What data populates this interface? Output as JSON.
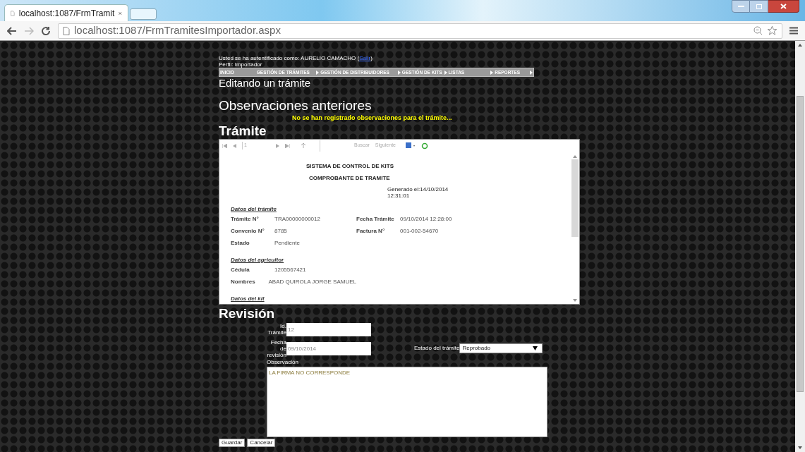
{
  "browser": {
    "tab_title": "localhost:1087/FrmTramit",
    "url": "localhost:1087/FrmTramitesImportador.aspx"
  },
  "header": {
    "auth_text": "Usted se ha autentificado como: AURELIO CAMACHO (",
    "logout_link": "Salir",
    "auth_end": ")",
    "profile": "Perfil: Importador"
  },
  "nav": [
    {
      "label": "INICIO",
      "submenu": false
    },
    {
      "label": "GESTIÓN DE TRÁMITES",
      "submenu": true
    },
    {
      "label": "GESTIÓN DE DISTRIBUIDORES",
      "submenu": true
    },
    {
      "label": "GESTIÓN DE KITS",
      "submenu": true
    },
    {
      "label": "LISTAS",
      "submenu": true
    },
    {
      "label": "REPORTES",
      "submenu": true
    }
  ],
  "page_title": "Editando un trámite",
  "observations": {
    "title": "Observaciones anteriores",
    "message": "No se han registrado observaciones para el trámite..."
  },
  "tramite_title": "Trámite",
  "report": {
    "page": "1",
    "find_label": "Buscar",
    "next_label": "Siguiente",
    "title": "SISTEMA DE CONTROL DE KITS",
    "subtitle": "COMPROBANTE DE TRAMITE",
    "generated": "Generado el:14/10/2014",
    "generated_time": "12:31:01",
    "sections": [
      {
        "title": "Datos del trámite",
        "rows": [
          [
            {
              "label": "Trámite N°",
              "value": "TRA00000000012"
            },
            {
              "label": "Fecha Trámite",
              "value": "09/10/2014 12:28:00"
            }
          ],
          [
            {
              "label": "Convenio N°",
              "value": "8785"
            },
            {
              "label": "Factura N°",
              "value": "001-002-54670"
            }
          ],
          [
            {
              "label": "Estado",
              "value": "Pendiente"
            }
          ]
        ]
      },
      {
        "title": "Datos del agricultor",
        "rows": [
          [
            {
              "label": "Cédula",
              "value": "1205567421"
            }
          ],
          [
            {
              "label": "Nombres",
              "value": "ABAD QUIROLA JORGE SAMUEL"
            }
          ]
        ]
      },
      {
        "title": "Datos del kit"
      }
    ]
  },
  "revision": {
    "title": "Revisión",
    "id_label": "Id. Trámite",
    "id_value": "12",
    "date_label": "Fecha de revisión",
    "date_value": "09/10/2014",
    "status_label": "Estado del trámite",
    "status_value": "Reprobado",
    "obs_label": "Observación",
    "obs_value": "LA FIRMA NO CORRESPONDE"
  },
  "buttons": [
    "Guardar",
    "Cancelar"
  ]
}
